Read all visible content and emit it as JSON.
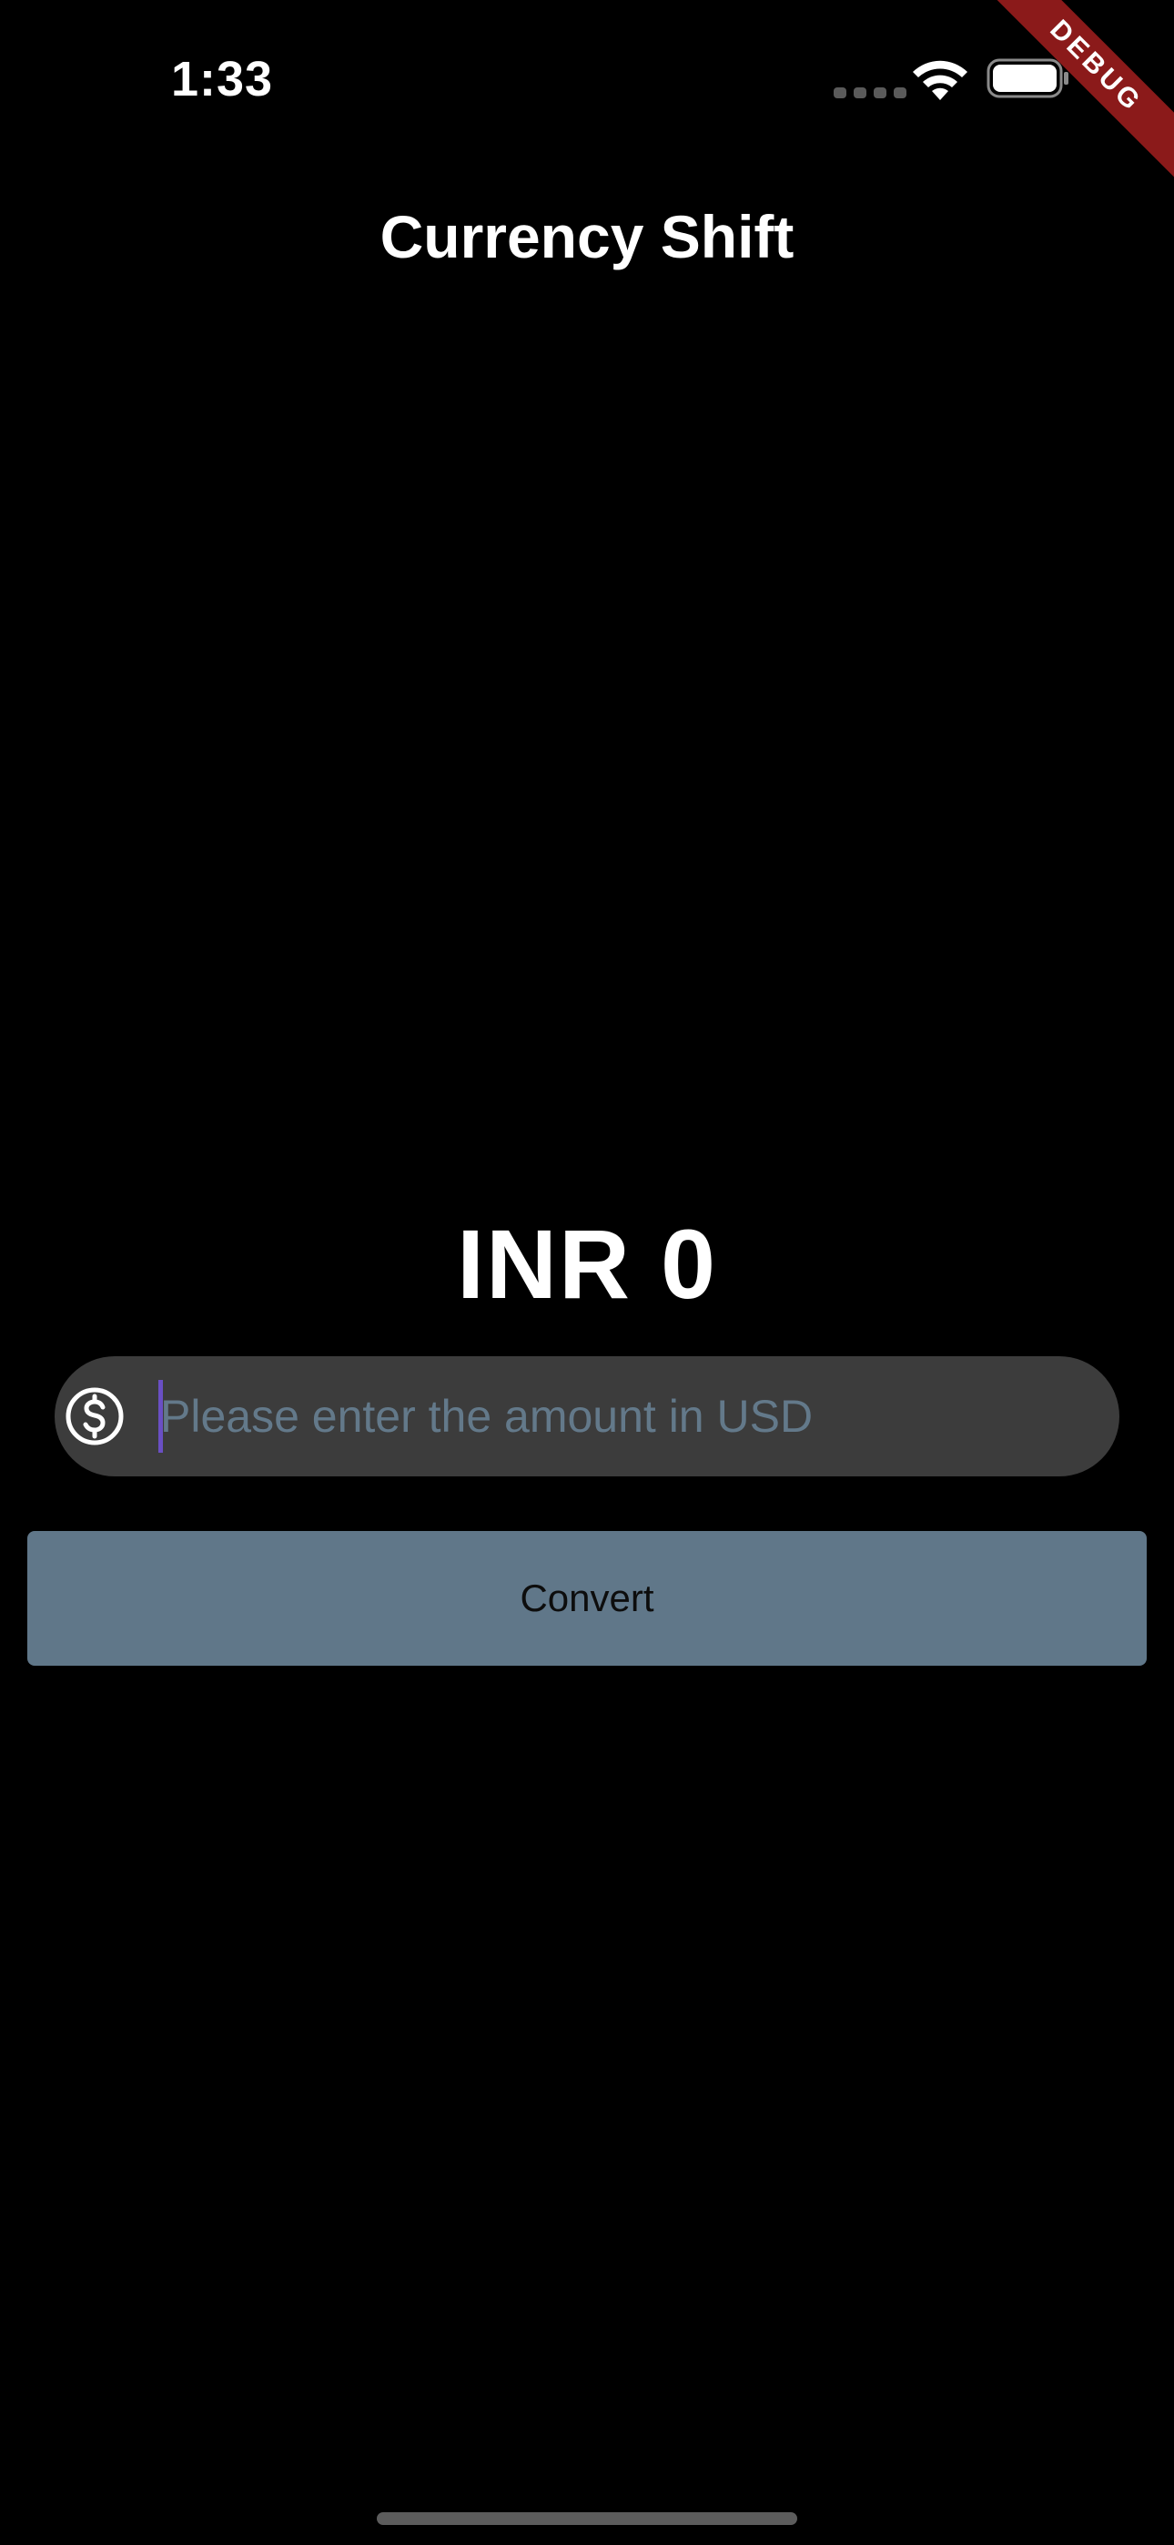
{
  "status_bar": {
    "time": "1:33",
    "icons": [
      "signal-dots-icon",
      "wifi-icon",
      "battery-icon"
    ]
  },
  "debug_banner": {
    "label": "DEBUG",
    "color": "#8b1a1a"
  },
  "header": {
    "title": "Currency Shift"
  },
  "result": {
    "text": "INR 0"
  },
  "amount_field": {
    "value": "",
    "placeholder": "Please enter the amount in USD",
    "prefix_icon": "dollar-circle-icon",
    "background": "#3c3c3c",
    "caret_color": "#6a4fc4"
  },
  "convert_button": {
    "label": "Convert",
    "background": "#607789"
  },
  "colors": {
    "background": "#000000",
    "text": "#ffffff",
    "placeholder": "#63798a"
  }
}
